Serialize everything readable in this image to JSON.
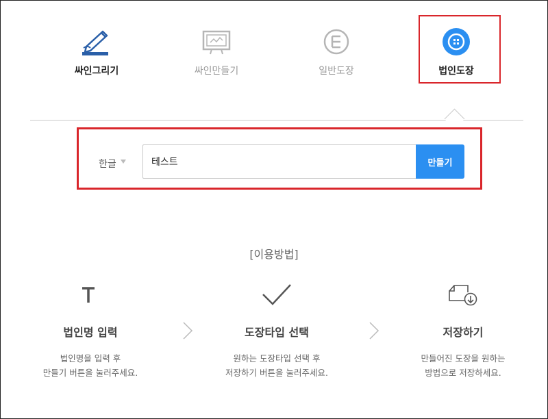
{
  "tabs": [
    {
      "label": "싸인그리기",
      "icon": "pen-sign-icon",
      "state": "dark"
    },
    {
      "label": "싸인만들기",
      "icon": "monitor-sign-icon",
      "state": "inactive"
    },
    {
      "label": "일반도장",
      "icon": "stamp-circle-icon",
      "state": "inactive"
    },
    {
      "label": "법인도장",
      "icon": "corporate-stamp-icon",
      "state": "selected"
    }
  ],
  "form": {
    "language": "한글",
    "input_value": "테스트",
    "submit_label": "만들기"
  },
  "howto": {
    "title": "[이용방법]",
    "steps": [
      {
        "icon": "text-t-icon",
        "title": "법인명 입력",
        "desc1": "법인명을 입력 후",
        "desc2": "만들기 버튼을 눌러주세요."
      },
      {
        "icon": "checkmark-icon",
        "title": "도장타입 선택",
        "desc1": "원하는 도장타입 선택 후",
        "desc2": "저장하기 버튼을 눌러주세요."
      },
      {
        "icon": "download-file-icon",
        "title": "저장하기",
        "desc1": "만들어진 도장을 원하는",
        "desc2": "방법으로 저장하세요."
      }
    ]
  },
  "colors": {
    "accent": "#2b8ff1",
    "highlight": "#d9262b",
    "pen_icon": "#2a5fa8"
  }
}
